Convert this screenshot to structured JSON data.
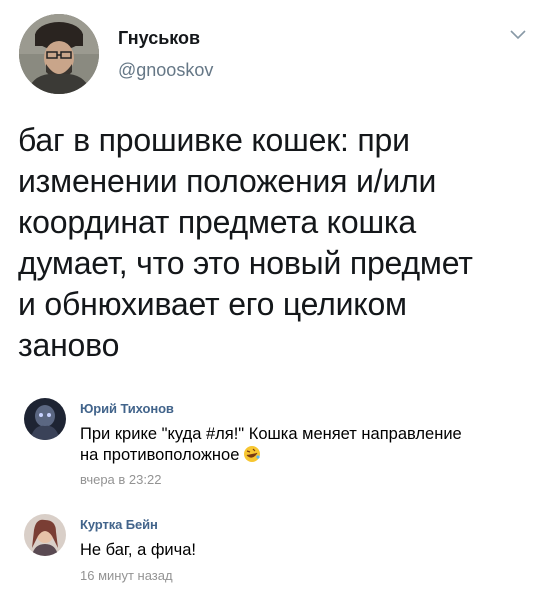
{
  "tweet": {
    "author": {
      "display_name": "Гнуськов",
      "handle": "@gnooskov"
    },
    "text_lines": [
      "баг в прошивке кошек: при",
      "изменении положения и/или",
      "координат предмета кошка",
      "думает, что это новый предмет",
      "и обнюхивает его целиком",
      "заново"
    ],
    "menu_icon": "chevron-down-icon"
  },
  "comments": [
    {
      "author": "Юрий Тихонов",
      "text_lines": [
        "При крике \"куда #ля!\" Кошка меняет направление",
        "на противоположное"
      ],
      "emoji": "rofl-emoji",
      "time": "вчера в 23:22"
    },
    {
      "author": "Куртка Бейн",
      "text_lines": [
        "Не баг, а фича!"
      ],
      "time": "16 минут назад"
    }
  ]
}
